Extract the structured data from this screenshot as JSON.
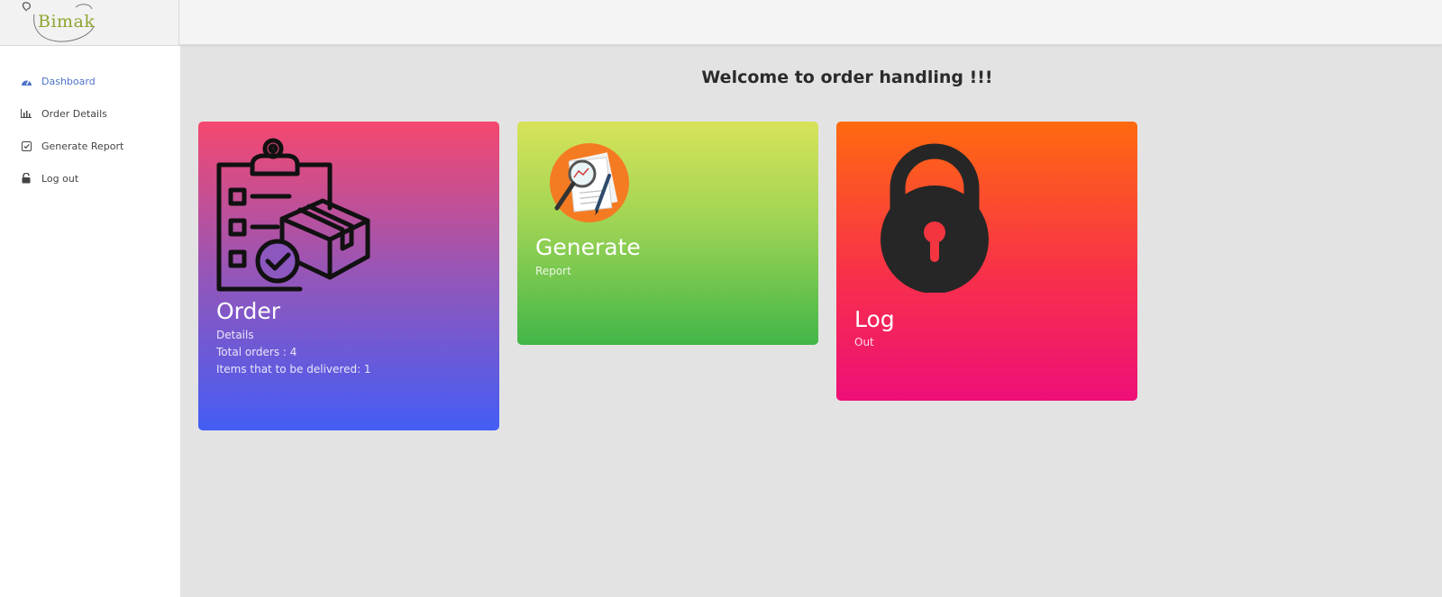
{
  "brand": {
    "logo_text": "Bimak"
  },
  "sidebar": {
    "items": [
      {
        "label": "Dashboard",
        "icon": "speedometer-icon"
      },
      {
        "label": "Order Details",
        "icon": "bar-chart-icon"
      },
      {
        "label": "Generate Report",
        "icon": "checkbox-icon"
      },
      {
        "label": "Log out",
        "icon": "unlock-icon"
      }
    ]
  },
  "main": {
    "title": "Welcome to order handling !!!",
    "cards": {
      "order": {
        "title": "Order",
        "subtitle": "Details",
        "total_orders": "Total orders : 4",
        "items_to_deliver": "Items that to be delivered: 1",
        "icon": "clipboard-package-icon"
      },
      "report": {
        "title": "Generate",
        "subtitle": "Report",
        "icon": "report-magnifier-icon"
      },
      "logout": {
        "title": "Log",
        "subtitle": "Out",
        "icon": "padlock-icon"
      }
    }
  },
  "colors": {
    "accent": "#4e73c9",
    "order_gradient": [
      "#f5486f",
      "#9456b9",
      "#445df5"
    ],
    "report_gradient": [
      "#d7e35a",
      "#9fd454",
      "#42b649"
    ],
    "logout_gradient": [
      "#ff6a0f",
      "#f8304a",
      "#ee0f78"
    ]
  }
}
